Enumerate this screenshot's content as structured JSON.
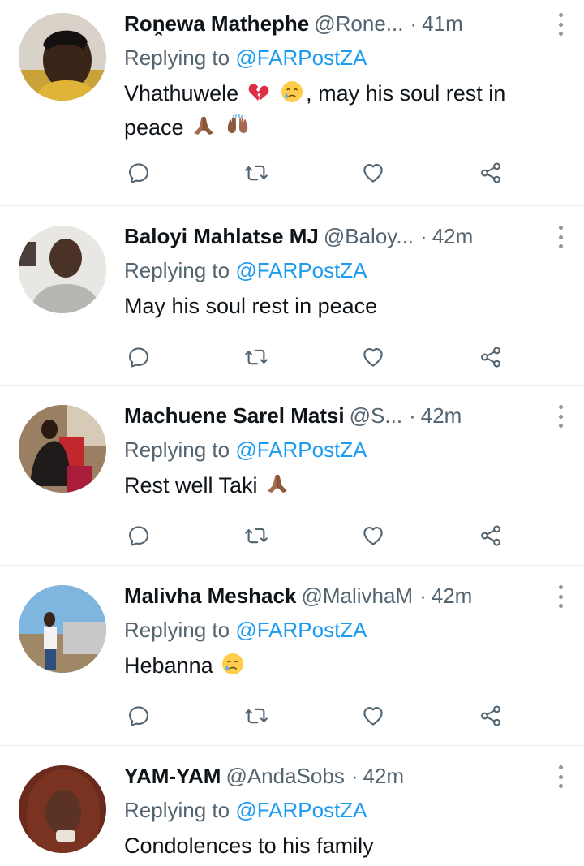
{
  "tweets": [
    {
      "name": "Roṋewa Mathephe",
      "handle": "@Rone...",
      "dot": "·",
      "time": "41m",
      "replying_prefix": "Replying to",
      "replying_to": "@FARPostZA",
      "text_parts": [
        "Vhathuwele",
        ", may his soul rest in",
        "peace"
      ],
      "emoji_icons": [
        "broken-heart-emoji",
        "crying-face-emoji",
        "folded-hands-emoji",
        "raising-hands-emoji"
      ]
    },
    {
      "name": "Baloyi Mahlatse MJ",
      "handle": "@Baloy...",
      "dot": "·",
      "time": "42m",
      "replying_prefix": "Replying to",
      "replying_to": "@FARPostZA",
      "text": "May his soul rest in peace"
    },
    {
      "name": "Machuene Sarel Matsi",
      "handle": "@S...",
      "dot": "·",
      "time": "42m",
      "replying_prefix": "Replying to",
      "replying_to": "@FARPostZA",
      "text": "Rest well Taki",
      "emoji_icons": [
        "folded-hands-emoji"
      ]
    },
    {
      "name": "Malivha Meshack",
      "handle": "@MalivhaM",
      "dot": "·",
      "time": "42m",
      "replying_prefix": "Replying to",
      "replying_to": "@FARPostZA",
      "text": "Hebanna",
      "emoji_icons": [
        "crying-face-emoji"
      ]
    },
    {
      "name": "YAM-YAM",
      "handle": "@AndaSobs",
      "dot": "·",
      "time": "42m",
      "replying_prefix": "Replying to",
      "replying_to": "@FARPostZA",
      "text": "Condolences to his family"
    }
  ],
  "action_icons": [
    "reply-icon",
    "retweet-icon",
    "like-icon",
    "share-icon"
  ],
  "colors": {
    "accent": "#1d9bf0",
    "secondary_text": "#536471",
    "primary_text": "#0f1419",
    "divider": "#e6ecf0"
  }
}
